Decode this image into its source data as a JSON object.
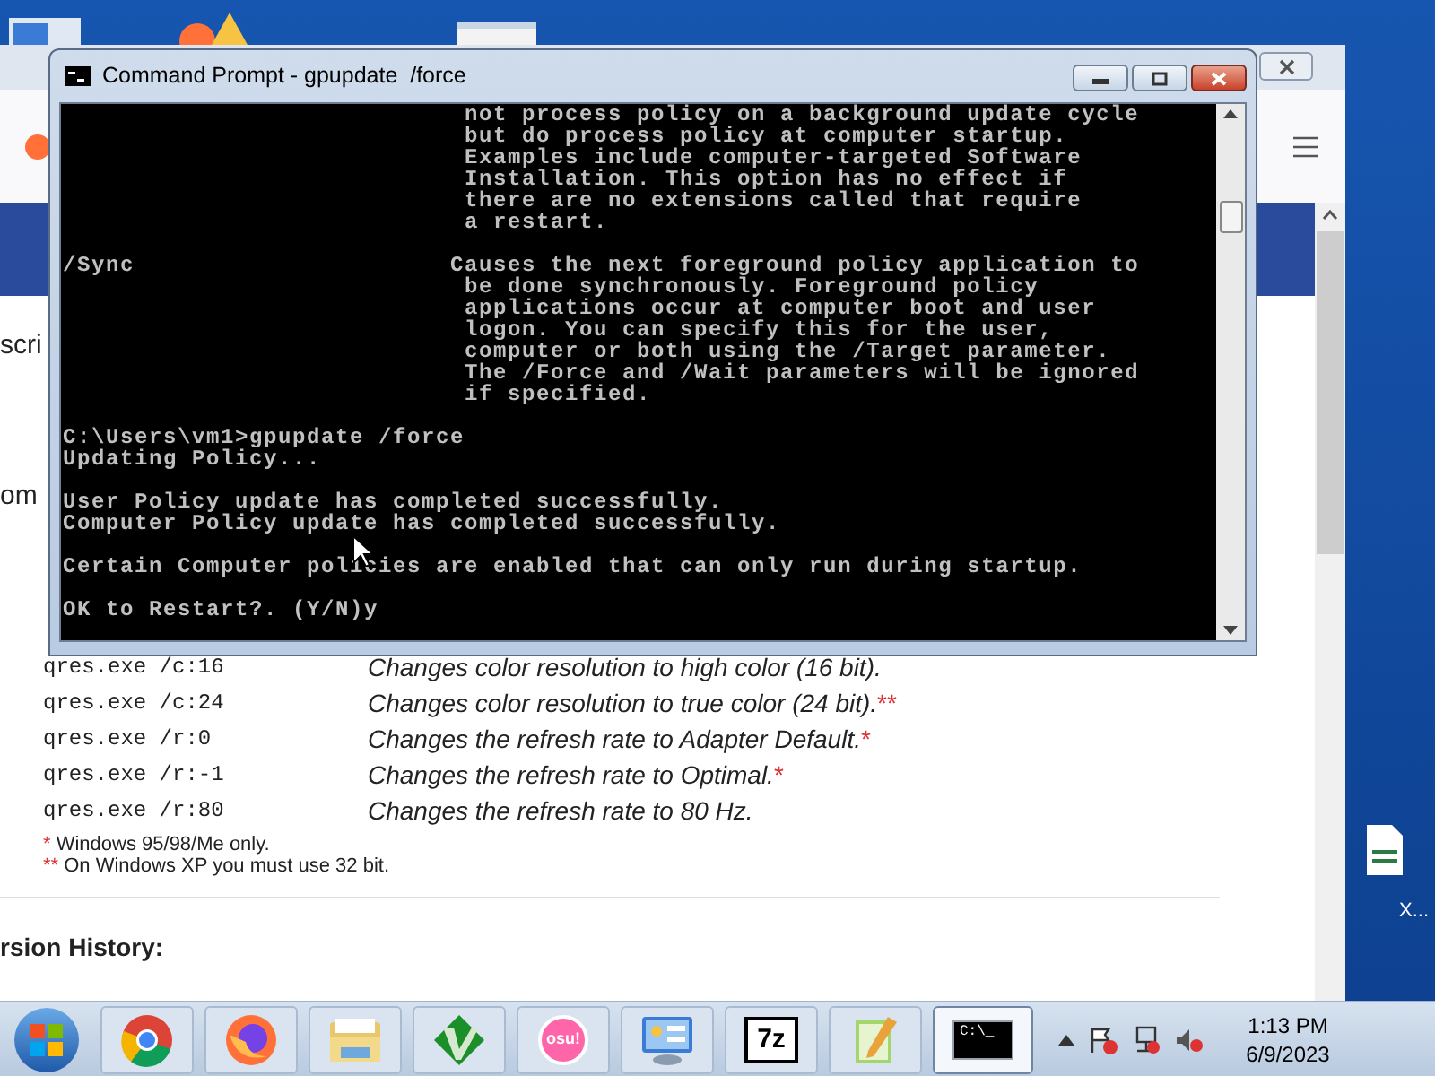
{
  "desktop_icons": [
    {
      "label": "X..."
    }
  ],
  "browser": {
    "heading_fragments": [
      "scri",
      "om"
    ],
    "commands": [
      {
        "command": "qres.exe /c:16",
        "description": "Changes color resolution to high color (16 bit)."
      },
      {
        "command": "qres.exe /c:24",
        "description": "Changes color resolution to true color (24 bit).",
        "note": "**"
      },
      {
        "command": "qres.exe /r:0",
        "description": "Changes the refresh rate to Adapter Default.",
        "note": "*"
      },
      {
        "command": "qres.exe /r:-1",
        "description": "Changes the refresh rate to Optimal.",
        "note": "*"
      },
      {
        "command": "qres.exe /r:80",
        "description": "Changes the refresh rate to 80 Hz."
      }
    ],
    "footnotes": [
      {
        "mark": "*",
        "text": "Windows 95/98/Me only."
      },
      {
        "mark": "**",
        "text": "On Windows XP you must use 32 bit."
      }
    ],
    "section_heading": "rsion History:"
  },
  "console": {
    "title": "Command Prompt - gpupdate  /force",
    "blocks": [
      [
        "                            not process policy on a background update cycle",
        "                            but do process policy at computer startup.",
        "                            Examples include computer-targeted Software",
        "                            Installation. This option has no effect if",
        "                            there are no extensions called that require",
        "                            a restart."
      ],
      [
        "/Sync                      Causes the next foreground policy application to",
        "                            be done synchronously. Foreground policy",
        "                            applications occur at computer boot and user",
        "                            logon. You can specify this for the user,",
        "                            computer or both using the /Target parameter.",
        "                            The /Force and /Wait parameters will be ignored",
        "                            if specified."
      ],
      [
        "C:\\Users\\vm1>gpupdate /force",
        "Updating Policy..."
      ],
      [
        "User Policy update has completed successfully.",
        "Computer Policy update has completed successfully."
      ],
      [
        "Certain Computer policies are enabled that can only run during startup."
      ],
      [
        "OK to Restart?. (Y/N)y"
      ]
    ]
  },
  "taskbar": {
    "items": [
      {
        "kind": "chrome",
        "selected": false
      },
      {
        "kind": "firefox",
        "selected": false
      },
      {
        "kind": "explorer",
        "selected": false
      },
      {
        "kind": "vim",
        "selected": false
      },
      {
        "kind": "osu",
        "label": "osu!",
        "selected": false
      },
      {
        "kind": "controlpanel",
        "selected": false
      },
      {
        "kind": "archiver",
        "label": "7z",
        "selected": false
      },
      {
        "kind": "notepad",
        "selected": false
      },
      {
        "kind": "cmd",
        "label": "C:\\_",
        "selected": true
      }
    ],
    "clock": {
      "time": "1:13 PM",
      "date": "6/9/2023"
    }
  }
}
